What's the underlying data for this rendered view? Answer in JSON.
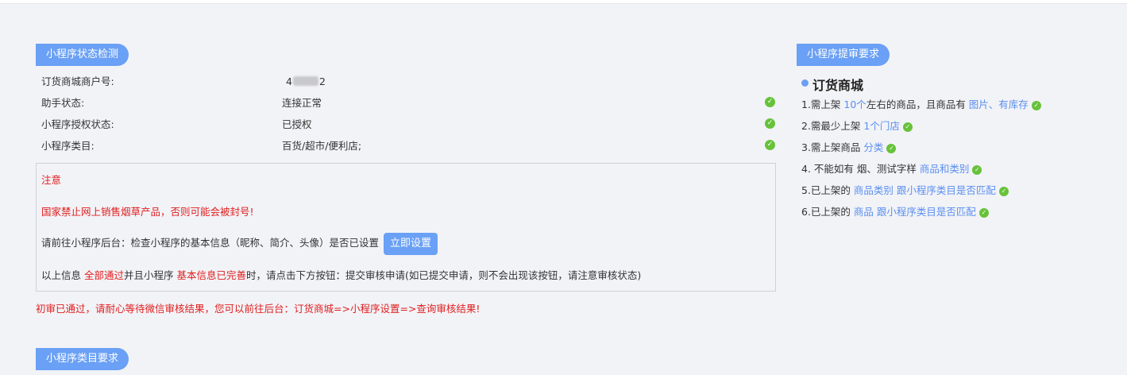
{
  "left": {
    "status_title": "小程序状态检测",
    "rows": [
      {
        "label": "订货商城商户号:",
        "value_prefix": "4",
        "value_suffix": "2"
      },
      {
        "label": "助手状态:",
        "value": "连接正常"
      },
      {
        "label": "小程序授权状态:",
        "value": "已授权"
      },
      {
        "label": "小程序类目:",
        "value": "百货/超市/便利店;"
      }
    ],
    "note": {
      "title": "注意",
      "warning": "国家禁止网上销售烟草产品，否则可能会被封号!",
      "check_text": "请前往小程序后台：检查小程序的基本信息（昵称、简介、头像）是否已设置",
      "setup_button": "立即设置",
      "info_p1": "以上信息 ",
      "info_red1": "全部通过",
      "info_p2": "并且小程序 ",
      "info_red2": "基本信息已完善",
      "info_p3": "时，请点击下方按钮：提交审核申请(如已提交申请，则不会出现该按钮，请注意审核状态)"
    },
    "passed_msg": "初审已通过，请耐心等待微信审核结果，您可以前往后台：订货商城=>小程序设置=>查询审核结果!",
    "category_title": "小程序类目要求"
  },
  "right": {
    "title": "小程序提审要求",
    "subtitle": "订货商城",
    "items": [
      {
        "pre": "1.需上架 ",
        "b1": "10个",
        "mid": "左右的商品，且商品有 ",
        "b2": "图片、有库存"
      },
      {
        "pre": "2.需最少上架 ",
        "b1": "1个门店",
        "mid": "",
        "b2": ""
      },
      {
        "pre": "3.需上架商品 ",
        "b1": "分类",
        "mid": "",
        "b2": ""
      },
      {
        "pre": "4. 不能如有 烟、测试字样 ",
        "b1": "商品和类别",
        "mid": "",
        "b2": ""
      },
      {
        "pre": "5.已上架的 ",
        "b1": "商品类别",
        "mid": " ",
        "b2": "跟小程序类目是否匹配"
      },
      {
        "pre": "6.已上架的 ",
        "b1": "商品",
        "mid": " ",
        "b2": "跟小程序类目是否匹配"
      }
    ]
  },
  "colors": {
    "accent": "#6aa0f5",
    "success": "#67c23a",
    "danger": "#e02020",
    "link": "#5b8ff0"
  }
}
